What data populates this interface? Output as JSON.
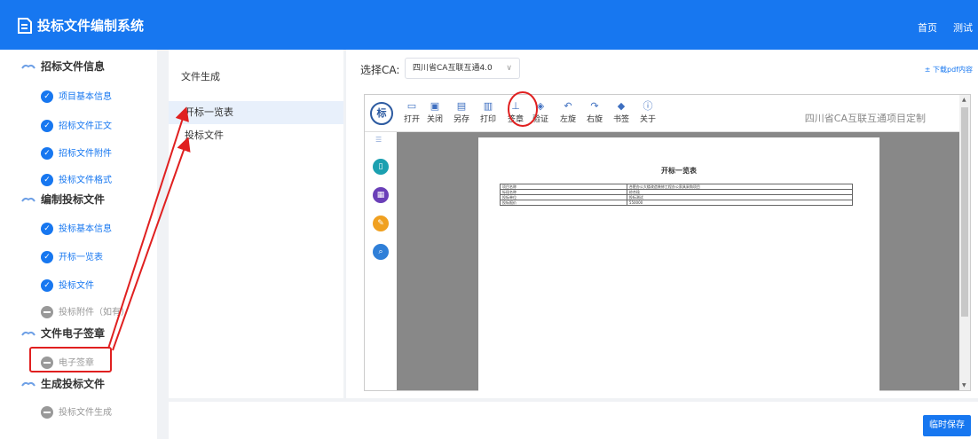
{
  "header": {
    "title": "投标文件编制系统",
    "nav_home": "首页",
    "nav_user": "测试",
    "logo_icon": "document-icon",
    "bg_color": "#1777f0"
  },
  "sidebar": {
    "sections": [
      {
        "title": "招标文件信息",
        "items": [
          {
            "label": "项目基本信息",
            "state": "done"
          },
          {
            "label": "招标文件正文",
            "state": "done"
          },
          {
            "label": "招标文件附件",
            "state": "done"
          },
          {
            "label": "投标文件格式",
            "state": "done"
          }
        ]
      },
      {
        "title": "编制投标文件",
        "items": [
          {
            "label": "投标基本信息",
            "state": "done"
          },
          {
            "label": "开标一览表",
            "state": "done"
          },
          {
            "label": "投标文件",
            "state": "done"
          },
          {
            "label": "投标附件（如有）",
            "state": "pending"
          }
        ]
      },
      {
        "title": "文件电子签章",
        "items": [
          {
            "label": "电子签章",
            "state": "pending"
          }
        ]
      },
      {
        "title": "生成投标文件",
        "items": [
          {
            "label": "投标文件生成",
            "state": "pending"
          }
        ]
      }
    ]
  },
  "file_list": {
    "heading": "文件生成",
    "items": [
      "开标一览表",
      "投标文件"
    ]
  },
  "ca": {
    "label": "选择CA:",
    "selected": "四川省CA互联互通4.0",
    "download": "± 下载pdf内容"
  },
  "viewer": {
    "logo_text": "标",
    "toolbar": [
      {
        "label": "打开",
        "icon": "folder-icon"
      },
      {
        "label": "关闭",
        "icon": "close-doc-icon"
      },
      {
        "label": "另存",
        "icon": "save-icon"
      },
      {
        "label": "打印",
        "icon": "print-icon"
      },
      {
        "label": "签章",
        "icon": "stamp-icon"
      },
      {
        "label": "验证",
        "icon": "shield-icon"
      },
      {
        "label": "左旋",
        "icon": "rotate-left-icon"
      },
      {
        "label": "右旋",
        "icon": "rotate-right-icon"
      },
      {
        "label": "书签",
        "icon": "bookmark-icon"
      },
      {
        "label": "关于",
        "icon": "info-icon"
      }
    ],
    "title": "四川省CA互联互通项目定制",
    "side_tools": [
      {
        "icon": "page-icon",
        "color": "#1ba0b0"
      },
      {
        "icon": "grid-icon",
        "color": "#6a3fb8"
      },
      {
        "icon": "pen-icon",
        "color": "#f0a020"
      },
      {
        "icon": "search-icon",
        "color": "#2f7fd8"
      }
    ],
    "document": {
      "title": "开标一览表",
      "rows": [
        [
          "项目名称",
          "合肥办公大楼改造装修工程办公家具采购项目"
        ],
        [
          "标段名称",
          "综合段"
        ],
        [
          "投标单位",
          "投标测试"
        ],
        [
          "投标报价",
          "550000"
        ]
      ]
    }
  },
  "footer": {
    "save_label": "临时保存"
  }
}
